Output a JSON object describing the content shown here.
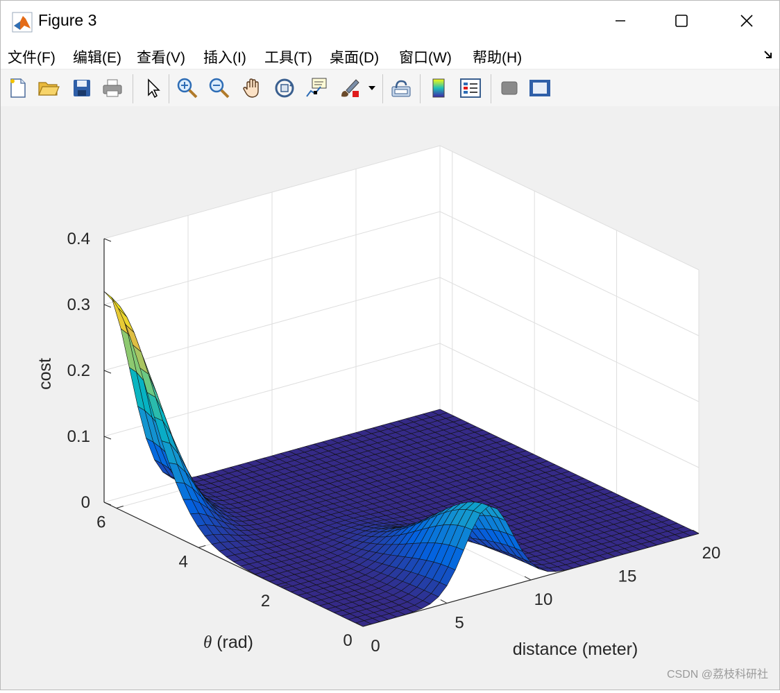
{
  "window": {
    "title": "Figure 3",
    "controls": [
      "minimize",
      "maximize",
      "close"
    ]
  },
  "menubar": {
    "items": [
      "文件(F)",
      "编辑(E)",
      "查看(V)",
      "插入(I)",
      "工具(T)",
      "桌面(D)",
      "窗口(W)",
      "帮助(H)"
    ]
  },
  "toolbar": {
    "buttons": [
      {
        "icon": "new-figure-icon"
      },
      {
        "icon": "open-icon"
      },
      {
        "icon": "save-icon"
      },
      {
        "icon": "print-icon"
      },
      {
        "icon": "select-arrow-icon"
      },
      {
        "icon": "zoom-in-icon"
      },
      {
        "icon": "zoom-out-icon"
      },
      {
        "icon": "pan-hand-icon"
      },
      {
        "icon": "rotate-3d-icon"
      },
      {
        "icon": "data-cursor-icon"
      },
      {
        "icon": "brush-icon"
      },
      {
        "icon": "link-plot-icon"
      },
      {
        "icon": "colorbar-icon"
      },
      {
        "icon": "legend-icon"
      },
      {
        "icon": "hide-plot-tools-icon"
      },
      {
        "icon": "show-plot-tools-icon"
      }
    ]
  },
  "chart_data": {
    "type": "surface",
    "title": "",
    "xlabel": "distance (meter)",
    "ylabel": "θ (rad)",
    "zlabel": "cost",
    "xlim": [
      0,
      20
    ],
    "ylim": [
      0,
      6.3
    ],
    "zlim": [
      0,
      0.4
    ],
    "xticks": [
      0,
      5,
      10,
      15,
      20
    ],
    "yticks": [
      0,
      2,
      4,
      6
    ],
    "zticks": [
      0,
      0.1,
      0.2,
      0.3,
      0.4
    ],
    "grid": true,
    "colormap": "parula",
    "surface_peaks": [
      {
        "distance": 0,
        "theta": 6.28,
        "cost": 0.32
      },
      {
        "distance": 7.5,
        "theta": 0,
        "cost": 0.13
      }
    ],
    "floor_cost": 0
  },
  "watermark": "CSDN @荔枝科研社"
}
